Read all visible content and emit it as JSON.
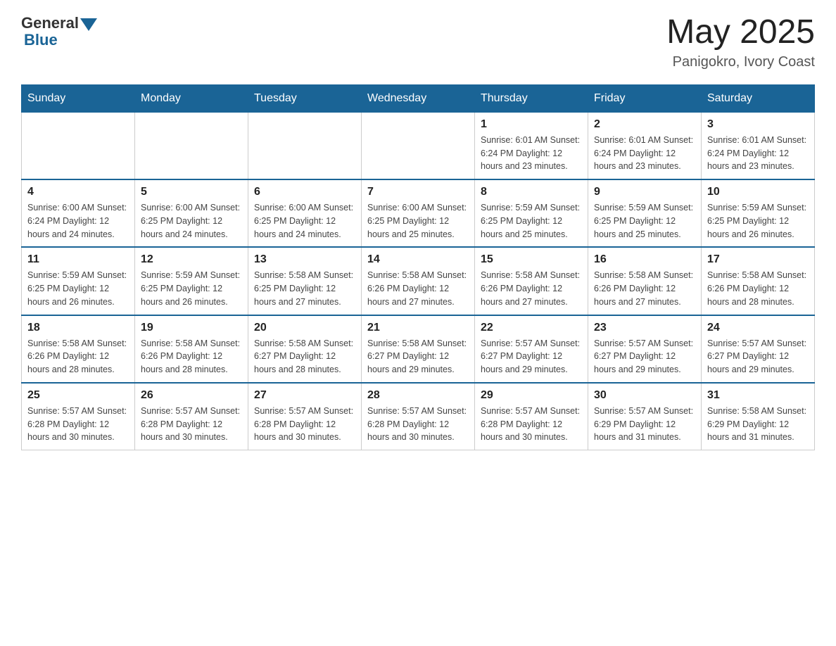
{
  "header": {
    "logo_general": "General",
    "logo_blue": "Blue",
    "month_title": "May 2025",
    "location": "Panigokro, Ivory Coast"
  },
  "days_of_week": [
    "Sunday",
    "Monday",
    "Tuesday",
    "Wednesday",
    "Thursday",
    "Friday",
    "Saturday"
  ],
  "weeks": [
    [
      {
        "day": "",
        "info": ""
      },
      {
        "day": "",
        "info": ""
      },
      {
        "day": "",
        "info": ""
      },
      {
        "day": "",
        "info": ""
      },
      {
        "day": "1",
        "info": "Sunrise: 6:01 AM\nSunset: 6:24 PM\nDaylight: 12 hours and 23 minutes."
      },
      {
        "day": "2",
        "info": "Sunrise: 6:01 AM\nSunset: 6:24 PM\nDaylight: 12 hours and 23 minutes."
      },
      {
        "day": "3",
        "info": "Sunrise: 6:01 AM\nSunset: 6:24 PM\nDaylight: 12 hours and 23 minutes."
      }
    ],
    [
      {
        "day": "4",
        "info": "Sunrise: 6:00 AM\nSunset: 6:24 PM\nDaylight: 12 hours and 24 minutes."
      },
      {
        "day": "5",
        "info": "Sunrise: 6:00 AM\nSunset: 6:25 PM\nDaylight: 12 hours and 24 minutes."
      },
      {
        "day": "6",
        "info": "Sunrise: 6:00 AM\nSunset: 6:25 PM\nDaylight: 12 hours and 24 minutes."
      },
      {
        "day": "7",
        "info": "Sunrise: 6:00 AM\nSunset: 6:25 PM\nDaylight: 12 hours and 25 minutes."
      },
      {
        "day": "8",
        "info": "Sunrise: 5:59 AM\nSunset: 6:25 PM\nDaylight: 12 hours and 25 minutes."
      },
      {
        "day": "9",
        "info": "Sunrise: 5:59 AM\nSunset: 6:25 PM\nDaylight: 12 hours and 25 minutes."
      },
      {
        "day": "10",
        "info": "Sunrise: 5:59 AM\nSunset: 6:25 PM\nDaylight: 12 hours and 26 minutes."
      }
    ],
    [
      {
        "day": "11",
        "info": "Sunrise: 5:59 AM\nSunset: 6:25 PM\nDaylight: 12 hours and 26 minutes."
      },
      {
        "day": "12",
        "info": "Sunrise: 5:59 AM\nSunset: 6:25 PM\nDaylight: 12 hours and 26 minutes."
      },
      {
        "day": "13",
        "info": "Sunrise: 5:58 AM\nSunset: 6:25 PM\nDaylight: 12 hours and 27 minutes."
      },
      {
        "day": "14",
        "info": "Sunrise: 5:58 AM\nSunset: 6:26 PM\nDaylight: 12 hours and 27 minutes."
      },
      {
        "day": "15",
        "info": "Sunrise: 5:58 AM\nSunset: 6:26 PM\nDaylight: 12 hours and 27 minutes."
      },
      {
        "day": "16",
        "info": "Sunrise: 5:58 AM\nSunset: 6:26 PM\nDaylight: 12 hours and 27 minutes."
      },
      {
        "day": "17",
        "info": "Sunrise: 5:58 AM\nSunset: 6:26 PM\nDaylight: 12 hours and 28 minutes."
      }
    ],
    [
      {
        "day": "18",
        "info": "Sunrise: 5:58 AM\nSunset: 6:26 PM\nDaylight: 12 hours and 28 minutes."
      },
      {
        "day": "19",
        "info": "Sunrise: 5:58 AM\nSunset: 6:26 PM\nDaylight: 12 hours and 28 minutes."
      },
      {
        "day": "20",
        "info": "Sunrise: 5:58 AM\nSunset: 6:27 PM\nDaylight: 12 hours and 28 minutes."
      },
      {
        "day": "21",
        "info": "Sunrise: 5:58 AM\nSunset: 6:27 PM\nDaylight: 12 hours and 29 minutes."
      },
      {
        "day": "22",
        "info": "Sunrise: 5:57 AM\nSunset: 6:27 PM\nDaylight: 12 hours and 29 minutes."
      },
      {
        "day": "23",
        "info": "Sunrise: 5:57 AM\nSunset: 6:27 PM\nDaylight: 12 hours and 29 minutes."
      },
      {
        "day": "24",
        "info": "Sunrise: 5:57 AM\nSunset: 6:27 PM\nDaylight: 12 hours and 29 minutes."
      }
    ],
    [
      {
        "day": "25",
        "info": "Sunrise: 5:57 AM\nSunset: 6:28 PM\nDaylight: 12 hours and 30 minutes."
      },
      {
        "day": "26",
        "info": "Sunrise: 5:57 AM\nSunset: 6:28 PM\nDaylight: 12 hours and 30 minutes."
      },
      {
        "day": "27",
        "info": "Sunrise: 5:57 AM\nSunset: 6:28 PM\nDaylight: 12 hours and 30 minutes."
      },
      {
        "day": "28",
        "info": "Sunrise: 5:57 AM\nSunset: 6:28 PM\nDaylight: 12 hours and 30 minutes."
      },
      {
        "day": "29",
        "info": "Sunrise: 5:57 AM\nSunset: 6:28 PM\nDaylight: 12 hours and 30 minutes."
      },
      {
        "day": "30",
        "info": "Sunrise: 5:57 AM\nSunset: 6:29 PM\nDaylight: 12 hours and 31 minutes."
      },
      {
        "day": "31",
        "info": "Sunrise: 5:58 AM\nSunset: 6:29 PM\nDaylight: 12 hours and 31 minutes."
      }
    ]
  ]
}
